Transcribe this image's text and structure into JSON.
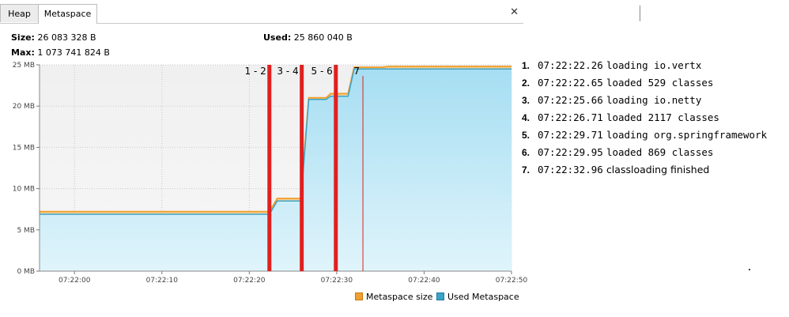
{
  "tabs": [
    {
      "label": "Heap",
      "active": false
    },
    {
      "label": "Metaspace",
      "active": true
    }
  ],
  "close_glyph": "✕",
  "stats": {
    "size_label": "Size:",
    "size_value": "26 083 328 B",
    "used_label": "Used:",
    "used_value": "25 860 040 B",
    "max_label": "Max:",
    "max_value": "1 073 741 824 B"
  },
  "chart_data": {
    "type": "area",
    "x_ticks": [
      "07:22:00",
      "07:22:10",
      "07:22:20",
      "07:22:30",
      "07:22:40",
      "07:22:50"
    ],
    "y_ticks": [
      "0 MB",
      "5 MB",
      "10 MB",
      "15 MB",
      "20 MB",
      "25 MB"
    ],
    "xlim": [
      "07:21:56",
      "07:22:50"
    ],
    "ylim": [
      0,
      25
    ],
    "grid": true,
    "legend_placement": "bottom-right",
    "series": [
      {
        "name": "Metaspace size",
        "color": "#f0a030",
        "points": [
          [
            "07:21:56",
            7.2
          ],
          [
            "07:22:22.3",
            7.2
          ],
          [
            "07:22:23.2",
            8.8
          ],
          [
            "07:22:25.9",
            8.8
          ],
          [
            "07:22:26.8",
            21.0
          ],
          [
            "07:22:28.8",
            21.0
          ],
          [
            "07:22:29.3",
            21.5
          ],
          [
            "07:22:31.3",
            21.5
          ],
          [
            "07:22:32.0",
            24.7
          ],
          [
            "07:22:35.2",
            24.7
          ],
          [
            "07:22:36.0",
            24.8
          ],
          [
            "07:22:50",
            24.8
          ]
        ]
      },
      {
        "name": "Used Metaspace",
        "color": "#3aa3c8",
        "points": [
          [
            "07:21:56",
            6.9
          ],
          [
            "07:22:22.3",
            6.9
          ],
          [
            "07:22:23.2",
            8.5
          ],
          [
            "07:22:25.9",
            8.5
          ],
          [
            "07:22:26.8",
            20.8
          ],
          [
            "07:22:28.8",
            20.8
          ],
          [
            "07:22:29.3",
            21.2
          ],
          [
            "07:22:31.3",
            21.2
          ],
          [
            "07:22:32.0",
            24.5
          ],
          [
            "07:22:50",
            24.5
          ]
        ]
      }
    ],
    "markers": [
      {
        "label": "1 - 2",
        "time": "07:22:22.3",
        "style": "thick"
      },
      {
        "label": "3 - 4",
        "time": "07:22:26.0",
        "style": "thick"
      },
      {
        "label": "5 - 6",
        "time": "07:22:29.9",
        "style": "thick"
      },
      {
        "label": "7",
        "time": "07:22:33.0",
        "style": "thin"
      }
    ]
  },
  "events": [
    {
      "num": "1.",
      "time": "07:22:22.26",
      "msg": "loading io.vertx",
      "sans": false
    },
    {
      "num": "2.",
      "time": "07:22:22.65",
      "msg": "loaded 529 classes",
      "sans": false
    },
    {
      "num": "3.",
      "time": "07:22:25.66",
      "msg": "loading io.netty",
      "sans": false
    },
    {
      "num": "4.",
      "time": "07:22:26.71",
      "msg": "loaded 2117 classes",
      "sans": false
    },
    {
      "num": "5.",
      "time": "07:22:29.71",
      "msg": "loading org.springframework",
      "sans": false
    },
    {
      "num": "6.",
      "time": "07:22:29.95",
      "msg": "loaded 869 classes",
      "sans": false
    },
    {
      "num": "7.",
      "time": "07:22:32.96",
      "msg": "classloading finished",
      "sans": true
    }
  ]
}
